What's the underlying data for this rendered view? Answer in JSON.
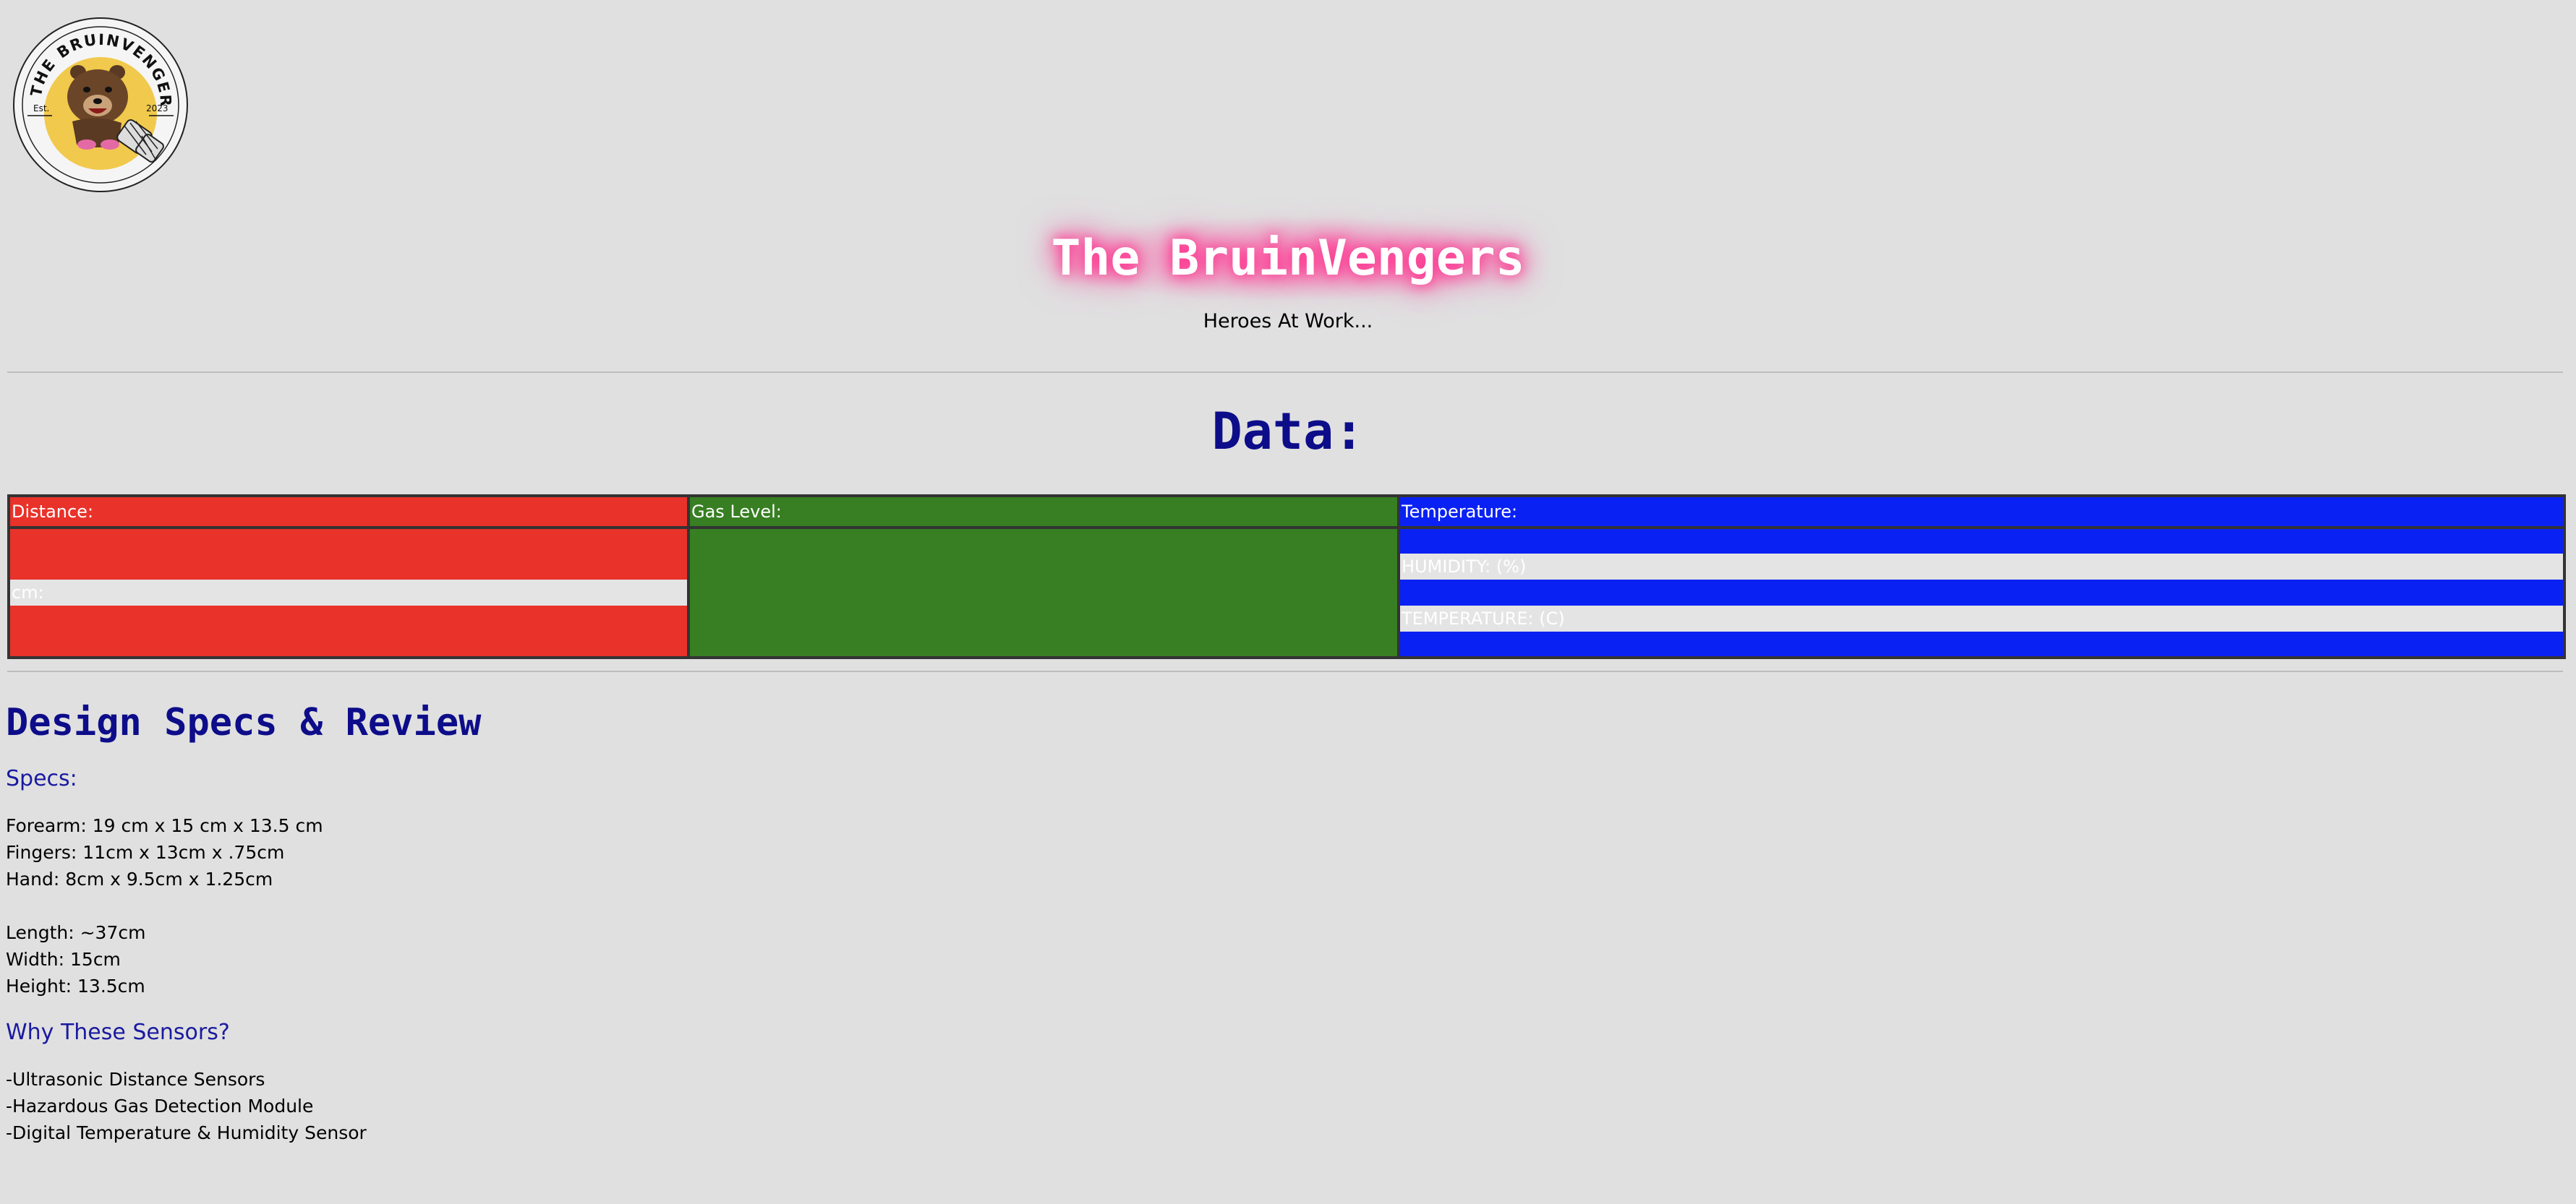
{
  "logo": {
    "ring_text": "THE BRUINVENGERS",
    "est_label": "Est.",
    "year_label": "2023"
  },
  "header": {
    "title": "The BruinVengers",
    "tagline": "Heroes At Work..."
  },
  "data_section": {
    "heading": "Data:",
    "columns": [
      {
        "label": "Distance:",
        "color": "#e8322a"
      },
      {
        "label": "Gas Level:",
        "color": "#377f22"
      },
      {
        "label": "Temperature:",
        "color": "#0a21f4"
      }
    ],
    "distance_reading": "cm:",
    "humidity_reading": "HUMIDITY: (%)",
    "temperature_reading": "TEMPERATURE: (C)"
  },
  "design": {
    "heading": "Design Specs & Review",
    "specs_heading": "Specs:",
    "specs_group1": [
      "Forearm: 19 cm x 15 cm x 13.5 cm",
      "Fingers: 11cm x 13cm x .75cm",
      "Hand: 8cm x 9.5cm x 1.25cm"
    ],
    "specs_group2": [
      "Length: ~37cm",
      "Width: 15cm",
      "Height: 13.5cm"
    ],
    "sensors_heading": "Why These Sensors?",
    "sensors": [
      "-Ultrasonic Distance Sensors",
      "-Hazardous Gas Detection Module",
      "-Digital Temperature & Humidity Sensor"
    ]
  },
  "colors": {
    "heading_navy": "#0d0d8a",
    "glow_pink": "#ff2a8a",
    "page_bg": "#e0e0e0"
  }
}
